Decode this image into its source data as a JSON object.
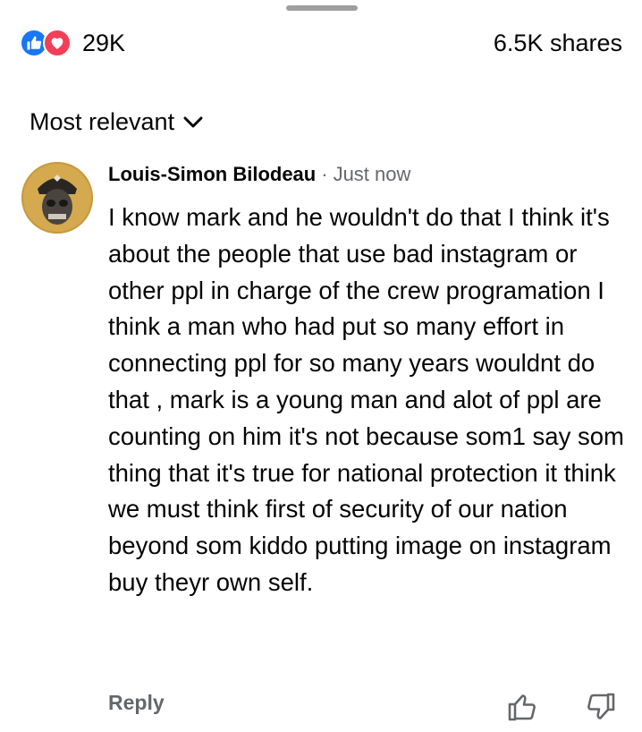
{
  "reactions": {
    "count": "29K",
    "icons": [
      "thumbs-up-icon",
      "heart-icon"
    ],
    "like_color": "#1877f2",
    "love_color": "#f33e58"
  },
  "shares": "6.5K shares",
  "sort": {
    "label": "Most relevant",
    "icon": "chevron-down-icon"
  },
  "comment": {
    "author": "Louis-Simon Bilodeau",
    "separator": "·",
    "timestamp": "Just now",
    "text": "I know mark and he wouldn't do that I think it's about the people that use bad instagram or other ppl in charge of the crew programation I think a man who had put so many effort in connecting ppl for so many years wouldnt do that , mark is a young man and alot of ppl are counting on him it's not because som1 say som thing that it's true for national protection it think we must think first of security of our nation beyond som kiddo putting image on instagram buy theyr own self.",
    "reply_label": "Reply"
  }
}
